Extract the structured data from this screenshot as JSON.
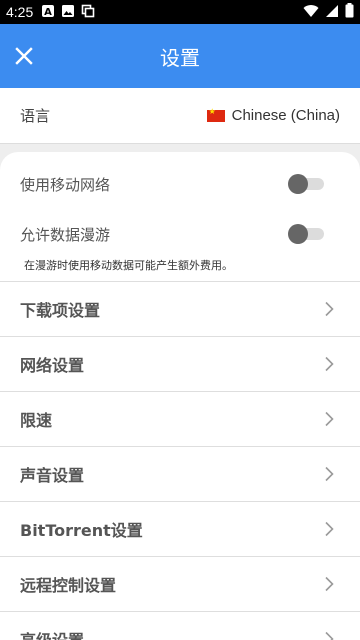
{
  "status_bar": {
    "time": "4:25",
    "icons_left": [
      "notification-a-icon",
      "image-icon",
      "screenshot-icon"
    ],
    "icons_right": [
      "wifi-icon",
      "signal-icon",
      "battery-icon"
    ]
  },
  "app_bar": {
    "title": "设置",
    "close_icon": "close-icon",
    "color": "#3c8cf0"
  },
  "language": {
    "label": "语言",
    "value": "Chinese (China)",
    "flag": "china-flag-icon"
  },
  "network": {
    "mobile_data_label": "使用移动网络",
    "mobile_data_on": false,
    "roaming_label": "允许数据漫游",
    "roaming_on": false,
    "roaming_hint": "在漫游时使用移动数据可能产生额外费用。"
  },
  "nav_items": [
    {
      "label": "下载项设置"
    },
    {
      "label": "网络设置"
    },
    {
      "label": "限速"
    },
    {
      "label": "声音设置"
    },
    {
      "label": "BitTorrent设置"
    },
    {
      "label": "远程控制设置"
    },
    {
      "label": "高级设置"
    }
  ]
}
